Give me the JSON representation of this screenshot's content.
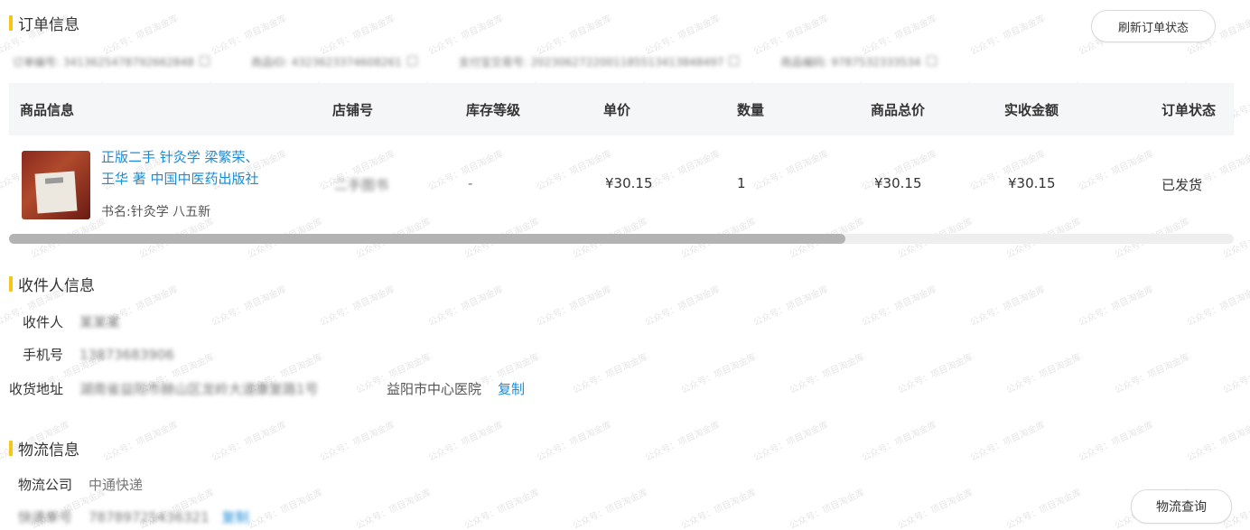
{
  "order": {
    "title": "订单信息",
    "refresh_button": "刷新订单状态",
    "meta": [
      {
        "label": "订单编号",
        "value": "3413625478792662848"
      },
      {
        "label": "商品ID",
        "value": "4323623374608261"
      },
      {
        "label": "支付宝交易号",
        "value": "2023062722001185513413848497"
      },
      {
        "label": "商品编码",
        "value": "9787532333534"
      }
    ],
    "columns": [
      "商品信息",
      "店铺号",
      "库存等级",
      "单价",
      "数量",
      "商品总价",
      "实收金额",
      "订单状态"
    ],
    "items": [
      {
        "title_line1": "正版二手 针灸学 梁繁荣、",
        "title_line2": "王华 著 中国中医药出版社",
        "subtitle": "书名:针灸学 八五新",
        "shop": "二手图书",
        "stock_level": "-",
        "unit_price": "¥30.15",
        "quantity": "1",
        "total_price": "¥30.15",
        "received": "¥30.15",
        "status": "已发货"
      }
    ],
    "scroll_fraction": 0.683
  },
  "recipient": {
    "title": "收件人信息",
    "name_label": "收件人",
    "name_value": "某某某",
    "phone_label": "手机号",
    "phone_value": "13873683906",
    "address_label": "收货地址",
    "address_value_hidden": "湖南省益阳市赫山区龙岭大道康复路1号",
    "address_visible": "益阳市中心医院",
    "copy_label": "复制"
  },
  "logistics": {
    "title": "物流信息",
    "company_label": "物流公司",
    "company_value": "中通快递",
    "tracking_label": "快递单号",
    "tracking_value": "78789725436321",
    "copy_label": "复制",
    "query_button": "物流查询"
  },
  "watermark": "公众号：项目淘金库",
  "colors": {
    "accent_bar": "#f5c518",
    "link": "#1a8cd8",
    "header_bg": "#f5f6f7"
  }
}
